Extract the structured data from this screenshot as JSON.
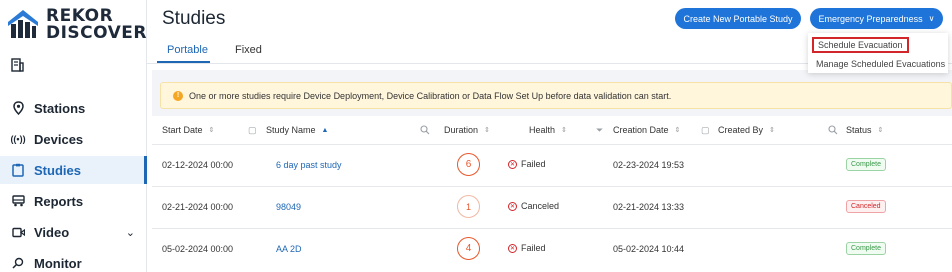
{
  "brand": {
    "line1": "REKOR",
    "line2": "DISCOVER"
  },
  "sidebar": {
    "items": [
      {
        "label": "Stations",
        "icon": "location-pin-icon"
      },
      {
        "label": "Devices",
        "icon": "broadcast-icon"
      },
      {
        "label": "Studies",
        "icon": "clipboard-icon",
        "active": true
      },
      {
        "label": "Reports",
        "icon": "truck-icon"
      },
      {
        "label": "Video",
        "icon": "video-camera-icon",
        "expandable": true
      },
      {
        "label": "Monitor",
        "icon": "magnify-icon"
      }
    ]
  },
  "header": {
    "title": "Studies",
    "create_button": "Create New Portable Study",
    "emergency_button": "Emergency Preparedness"
  },
  "tabs": [
    {
      "label": "Portable",
      "active": true
    },
    {
      "label": "Fixed"
    }
  ],
  "dropdown": {
    "items": [
      "Schedule Evacuation",
      "Manage Scheduled Evacuations"
    ],
    "highlighted": "Schedule Evacuation"
  },
  "warning": "One or more studies require Device Deployment, Device Calibration or Data Flow Set Up before data validation can start.",
  "table": {
    "columns": [
      "Start Date",
      "Study Name",
      "Duration",
      "Health",
      "Creation Date",
      "Created By",
      "Status"
    ],
    "rows": [
      {
        "start_date": "02-12-2024 00:00",
        "study_name": "6 day past study",
        "duration": "6",
        "health": "Failed",
        "creation_date": "02-23-2024 19:53",
        "status": "Complete"
      },
      {
        "start_date": "02-21-2024 00:00",
        "study_name": "98049",
        "duration": "1",
        "health": "Canceled",
        "creation_date": "02-21-2024 13:33",
        "status": "Canceled"
      },
      {
        "start_date": "05-02-2024 00:00",
        "study_name": "AA 2D",
        "duration": "4",
        "health": "Failed",
        "creation_date": "05-02-2024 10:44",
        "status": "Complete"
      }
    ]
  },
  "colors": {
    "accent": "#1e74d8",
    "duration_ring": "#e8572b",
    "danger": "#d2262a",
    "success": "#3a9a4a",
    "warning_bg": "#fff6dc"
  }
}
